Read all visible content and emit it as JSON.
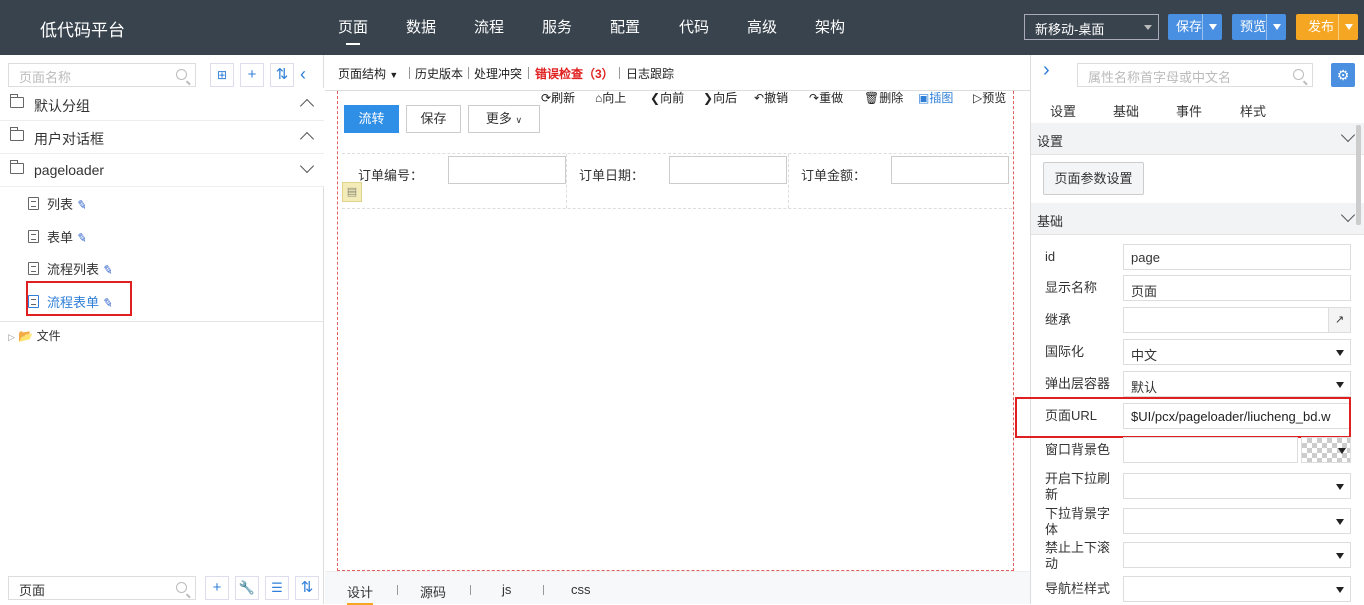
{
  "app": {
    "title": "低代码平台"
  },
  "nav": {
    "items": [
      "页面",
      "数据",
      "流程",
      "服务",
      "配置",
      "代码",
      "高级",
      "架构"
    ],
    "active": 0
  },
  "header": {
    "env": "新移动-桌面",
    "save": "保存",
    "preview": "预览",
    "publish": "发布"
  },
  "colors": {
    "topbar": "#39434d",
    "save": "#4a90e2",
    "preview": "#4a90e2",
    "publish": "#f5a623",
    "primary": "#2f8fe6",
    "error": "#e02020"
  },
  "left": {
    "search_placeholder": "页面名称",
    "groups": [
      "默认分组",
      "用户对话框",
      "pageloader"
    ],
    "pages": [
      "列表",
      "表单",
      "流程列表",
      "流程表单"
    ],
    "folder": "文件",
    "bottom_search": "页面"
  },
  "center": {
    "toolbar": {
      "structure": "页面结构",
      "history": "历史版本",
      "conflict": "处理冲突",
      "errors": "错误检查（3）",
      "logs": "日志跟踪"
    },
    "canvas_tools": [
      "刷新",
      "向上",
      "向前",
      "向后",
      "撤销",
      "重做",
      "删除",
      "插图",
      "预览"
    ],
    "form_buttons": {
      "flow": "流转",
      "save": "保存",
      "more": "更多"
    },
    "fields": [
      "订单编号：",
      "订单日期：",
      "订单金额："
    ],
    "bottom_tabs": [
      "设计",
      "源码",
      "js",
      "css"
    ]
  },
  "right": {
    "search_placeholder": "属性名称首字母或中文名",
    "tabs": [
      "设置",
      "基础",
      "事件",
      "样式"
    ],
    "section_settings": "设置",
    "page_params_button": "页面参数设置",
    "section_basic": "基础",
    "props": [
      {
        "label": "id",
        "value": "page"
      },
      {
        "label": "显示名称",
        "value": "页面"
      },
      {
        "label": "继承",
        "value": ""
      },
      {
        "label": "国际化",
        "value": "中文"
      },
      {
        "label": "弹出层容器",
        "value": "默认"
      },
      {
        "label": "页面URL",
        "value": "$UI/pcx/pageloader/liucheng_bd.w"
      },
      {
        "label": "窗口背景色",
        "value": ""
      },
      {
        "label": "开启下拉刷新",
        "value": ""
      },
      {
        "label": "下拉背景字体",
        "value": ""
      },
      {
        "label": "禁止上下滚动",
        "value": ""
      },
      {
        "label": "导航栏样式",
        "value": ""
      }
    ]
  }
}
